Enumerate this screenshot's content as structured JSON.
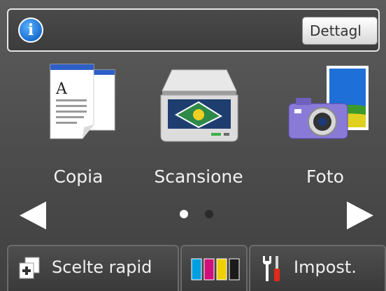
{
  "header": {
    "info_label": "i",
    "detail_label": "Dettagl"
  },
  "functions": [
    {
      "label": "Copia",
      "icon": "copy-icon"
    },
    {
      "label": "Scansione",
      "icon": "scanner-icon"
    },
    {
      "label": "Foto",
      "icon": "camera-photo-icon"
    }
  ],
  "pager": {
    "pages": 2,
    "current": 1
  },
  "bottom": {
    "shortcut_label": "Scelte rapid",
    "ink_icon": "ink-cartridges-icon",
    "settings_label": "Impost."
  },
  "colors": {
    "info": "#1a6fd0",
    "ink_cyan": "#00a0e0",
    "ink_magenta": "#d0107a",
    "ink_yellow": "#f0d000",
    "ink_black": "#1a1a1a"
  }
}
